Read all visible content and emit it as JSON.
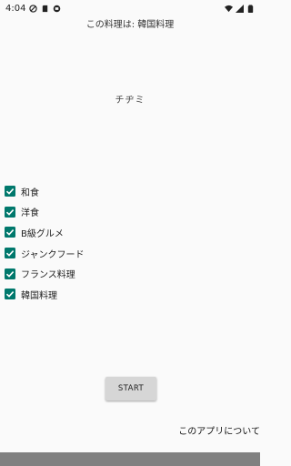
{
  "status_bar": {
    "time": "4:04",
    "left_icons": [
      "do-not-disturb-icon",
      "sim-card-icon",
      "app-notification-icon"
    ],
    "right_icons": [
      "wifi-icon",
      "signal-icon",
      "battery-icon"
    ]
  },
  "result": {
    "label": "この料理は: 韓国料理"
  },
  "dish": {
    "name": "チヂミ"
  },
  "categories": [
    {
      "label": "和食",
      "checked": true
    },
    {
      "label": "洋食",
      "checked": true
    },
    {
      "label": "B級グルメ",
      "checked": true
    },
    {
      "label": "ジャンクフード",
      "checked": true
    },
    {
      "label": "フランス料理",
      "checked": true
    },
    {
      "label": "韓国料理",
      "checked": true
    }
  ],
  "start_button": {
    "label": "START"
  },
  "about": {
    "label": "このアプリについて"
  },
  "colors": {
    "checkbox": "#00786c",
    "background": "#fafafa",
    "nav_bar": "#808080",
    "button": "#d6d6d6"
  }
}
